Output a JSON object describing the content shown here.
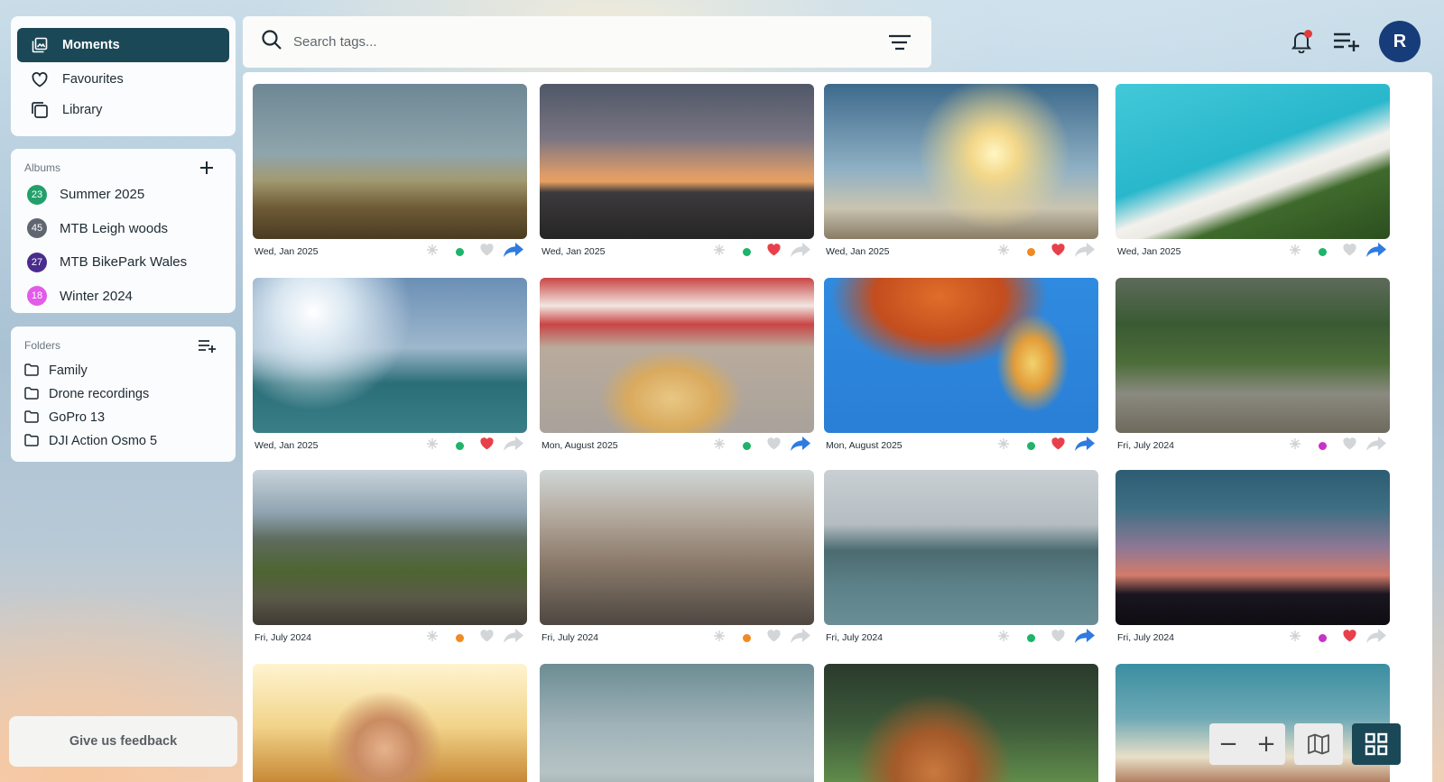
{
  "nav": {
    "items": [
      {
        "label": "Moments",
        "icon": "photo-stack-icon",
        "active": true
      },
      {
        "label": "Favourites",
        "icon": "heart-icon",
        "active": false
      },
      {
        "label": "Library",
        "icon": "library-icon",
        "active": false
      }
    ]
  },
  "albums": {
    "label": "Albums",
    "items": [
      {
        "count": "23",
        "name": "Summer 2025",
        "color": "#22a06b"
      },
      {
        "count": "45",
        "name": "MTB Leigh woods",
        "color": "#5f6670"
      },
      {
        "count": "27",
        "name": "MTB BikePark Wales",
        "color": "#4a2c8c"
      },
      {
        "count": "18",
        "name": "Winter 2024",
        "color": "#e25be9"
      }
    ]
  },
  "folders": {
    "label": "Folders",
    "items": [
      {
        "name": "Family"
      },
      {
        "name": "Drone recordings"
      },
      {
        "name": "GoPro 13"
      },
      {
        "name": "DJI Action Osmo 5"
      }
    ]
  },
  "feedback": {
    "label": "Give us feedback"
  },
  "search": {
    "placeholder": "Search tags..."
  },
  "user": {
    "initial": "R"
  },
  "colors": {
    "accent": "#1b4857",
    "green": "#1fb36b",
    "orange": "#f08a24",
    "purple": "#c633c8",
    "heart_red": "#e8404a",
    "share_blue": "#2f7be0",
    "muted": "#d3d6d8"
  },
  "photos": [
    {
      "date": "Wed, Jan 2025",
      "dot": "green",
      "liked": false,
      "shared": true,
      "scene": "mtb"
    },
    {
      "date": "Wed, Jan 2025",
      "dot": "green",
      "liked": true,
      "shared": false,
      "scene": "sunset-beach"
    },
    {
      "date": "Wed, Jan 2025",
      "dot": "orange",
      "liked": true,
      "shared": false,
      "scene": "sun-woman"
    },
    {
      "date": "Wed, Jan 2025",
      "dot": "green",
      "liked": false,
      "shared": true,
      "scene": "tropical"
    },
    {
      "date": "Wed, Jan 2025",
      "dot": "green",
      "liked": true,
      "shared": false,
      "scene": "dog"
    },
    {
      "date": "Mon, August 2025",
      "dot": "green",
      "liked": false,
      "shared": true,
      "scene": "cake"
    },
    {
      "date": "Mon, August 2025",
      "dot": "green",
      "liked": true,
      "shared": true,
      "scene": "balloons"
    },
    {
      "date": "Fri, July 2024",
      "dot": "purple",
      "liked": false,
      "shared": false,
      "scene": "family-walk"
    },
    {
      "date": "Fri, July 2024",
      "dot": "orange",
      "liked": false,
      "shared": false,
      "scene": "mountain"
    },
    {
      "date": "Fri, July 2024",
      "dot": "orange",
      "liked": false,
      "shared": false,
      "scene": "hikers"
    },
    {
      "date": "Fri, July 2024",
      "dot": "green",
      "liked": false,
      "shared": true,
      "scene": "paddle"
    },
    {
      "date": "Fri, July 2024",
      "dot": "purple",
      "liked": true,
      "shared": false,
      "scene": "palms"
    },
    {
      "date": "",
      "scene": "hat-woman"
    },
    {
      "date": "",
      "scene": "clouds"
    },
    {
      "date": "",
      "scene": "squirrel"
    },
    {
      "date": "",
      "scene": "town"
    }
  ],
  "controls": {
    "zoom_out": "−",
    "zoom_in": "+",
    "map_icon": "map-icon",
    "grid_icon": "grid-icon"
  }
}
